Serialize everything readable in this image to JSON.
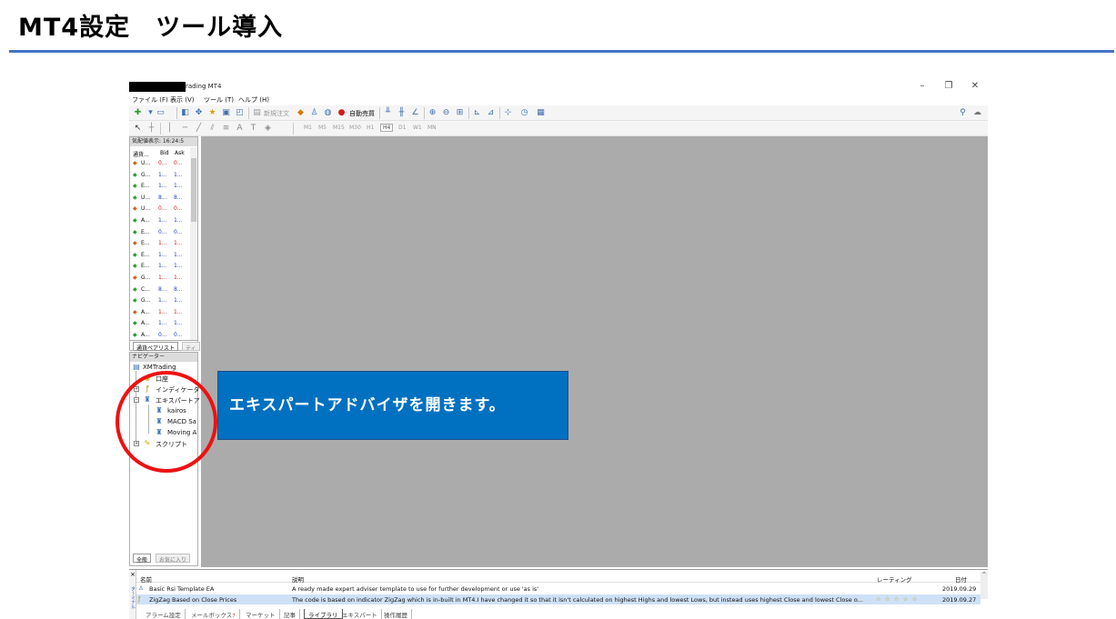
{
  "slide": {
    "title": "MT4設定　ツール導入",
    "accent": "#4472c4"
  },
  "window": {
    "title": "rading MT4",
    "controls": {
      "minimize": "–",
      "restore": "❐",
      "close": "✕"
    }
  },
  "menu": [
    "ファイル (F)",
    "表示 (V)",
    "ツール (T)",
    "ヘルプ (H)"
  ],
  "toolbar": {
    "new_order": "新規注文",
    "auto_trade": "自動売買"
  },
  "timeframes": [
    "M1",
    "M5",
    "M15",
    "M30",
    "H1",
    "H4",
    "D1",
    "W1",
    "MN"
  ],
  "timeframe_active": "H4",
  "market_watch": {
    "header": "気配値表示: 16:24:5",
    "columns": [
      "通貨...",
      "Bid",
      "Ask"
    ],
    "rows": [
      {
        "dir": "down",
        "symbol": "U...",
        "bid": "0...",
        "ask": "0...",
        "color": "red"
      },
      {
        "dir": "up",
        "symbol": "G...",
        "bid": "1...",
        "ask": "1...",
        "color": "blue"
      },
      {
        "dir": "up",
        "symbol": "E...",
        "bid": "1...",
        "ask": "1...",
        "color": "blue"
      },
      {
        "dir": "up",
        "symbol": "U...",
        "bid": "8...",
        "ask": "8...",
        "color": "blue"
      },
      {
        "dir": "down",
        "symbol": "U...",
        "bid": "0...",
        "ask": "0...",
        "color": "red"
      },
      {
        "dir": "up",
        "symbol": "A...",
        "bid": "1...",
        "ask": "1...",
        "color": "blue"
      },
      {
        "dir": "up",
        "symbol": "E...",
        "bid": "0...",
        "ask": "0...",
        "color": "blue"
      },
      {
        "dir": "down",
        "symbol": "E...",
        "bid": "1...",
        "ask": "1...",
        "color": "red"
      },
      {
        "dir": "up",
        "symbol": "E...",
        "bid": "1...",
        "ask": "1...",
        "color": "blue"
      },
      {
        "dir": "up",
        "symbol": "E...",
        "bid": "1...",
        "ask": "1...",
        "color": "blue"
      },
      {
        "dir": "down",
        "symbol": "G...",
        "bid": "1...",
        "ask": "1...",
        "color": "red"
      },
      {
        "dir": "up",
        "symbol": "C...",
        "bid": "8...",
        "ask": "8...",
        "color": "blue"
      },
      {
        "dir": "up",
        "symbol": "G...",
        "bid": "1...",
        "ask": "1...",
        "color": "blue"
      },
      {
        "dir": "down",
        "symbol": "A...",
        "bid": "1...",
        "ask": "1...",
        "color": "red"
      },
      {
        "dir": "up",
        "symbol": "A...",
        "bid": "1...",
        "ask": "1...",
        "color": "blue"
      },
      {
        "dir": "up",
        "symbol": "A...",
        "bid": "0...",
        "ask": "0...",
        "color": "blue"
      }
    ],
    "tabs": [
      "通貨ペアリスト",
      "ティ"
    ]
  },
  "navigator": {
    "header": "ナビゲーター",
    "root": "XMTrading",
    "items": [
      "口座",
      "インディケータ",
      "エキスパートアド",
      "スクリプト"
    ],
    "experts": [
      "kairos",
      "MACD Sa",
      "Moving A"
    ],
    "tabs": [
      "全般",
      "お気に入り"
    ]
  },
  "callout": {
    "text": "エキスパートアドバイザを開きます。",
    "color": "#0070c0"
  },
  "terminal": {
    "columns": {
      "name": "名前",
      "desc": "説明",
      "rating": "レーティング",
      "date": "日付"
    },
    "rows": [
      {
        "name": "Basic Rsi Template EA",
        "desc": "A ready made expert adviser template to use for further development or use 'as is'",
        "rating": "",
        "date": "2019.09.29"
      },
      {
        "name": "ZigZag Based on Close Prices",
        "desc": "The code is based on indicator ZigZag which is in-built in MT4.I have changed it so that it isn't calculated on highest Highs and lowest Lows, but instead uses highest Close and lowest Close o...",
        "rating": "☆ ☆ ☆ ☆ ☆",
        "date": "2019.09.27"
      }
    ],
    "tabs": [
      "アラーム設定",
      "メールボックス",
      "マーケット",
      "記事",
      "ライブラリ",
      "エキスパート",
      "操作履歴"
    ],
    "mailbox_badge": "7",
    "active_tab": "ライブラリ",
    "side_label": "ターミナル"
  }
}
